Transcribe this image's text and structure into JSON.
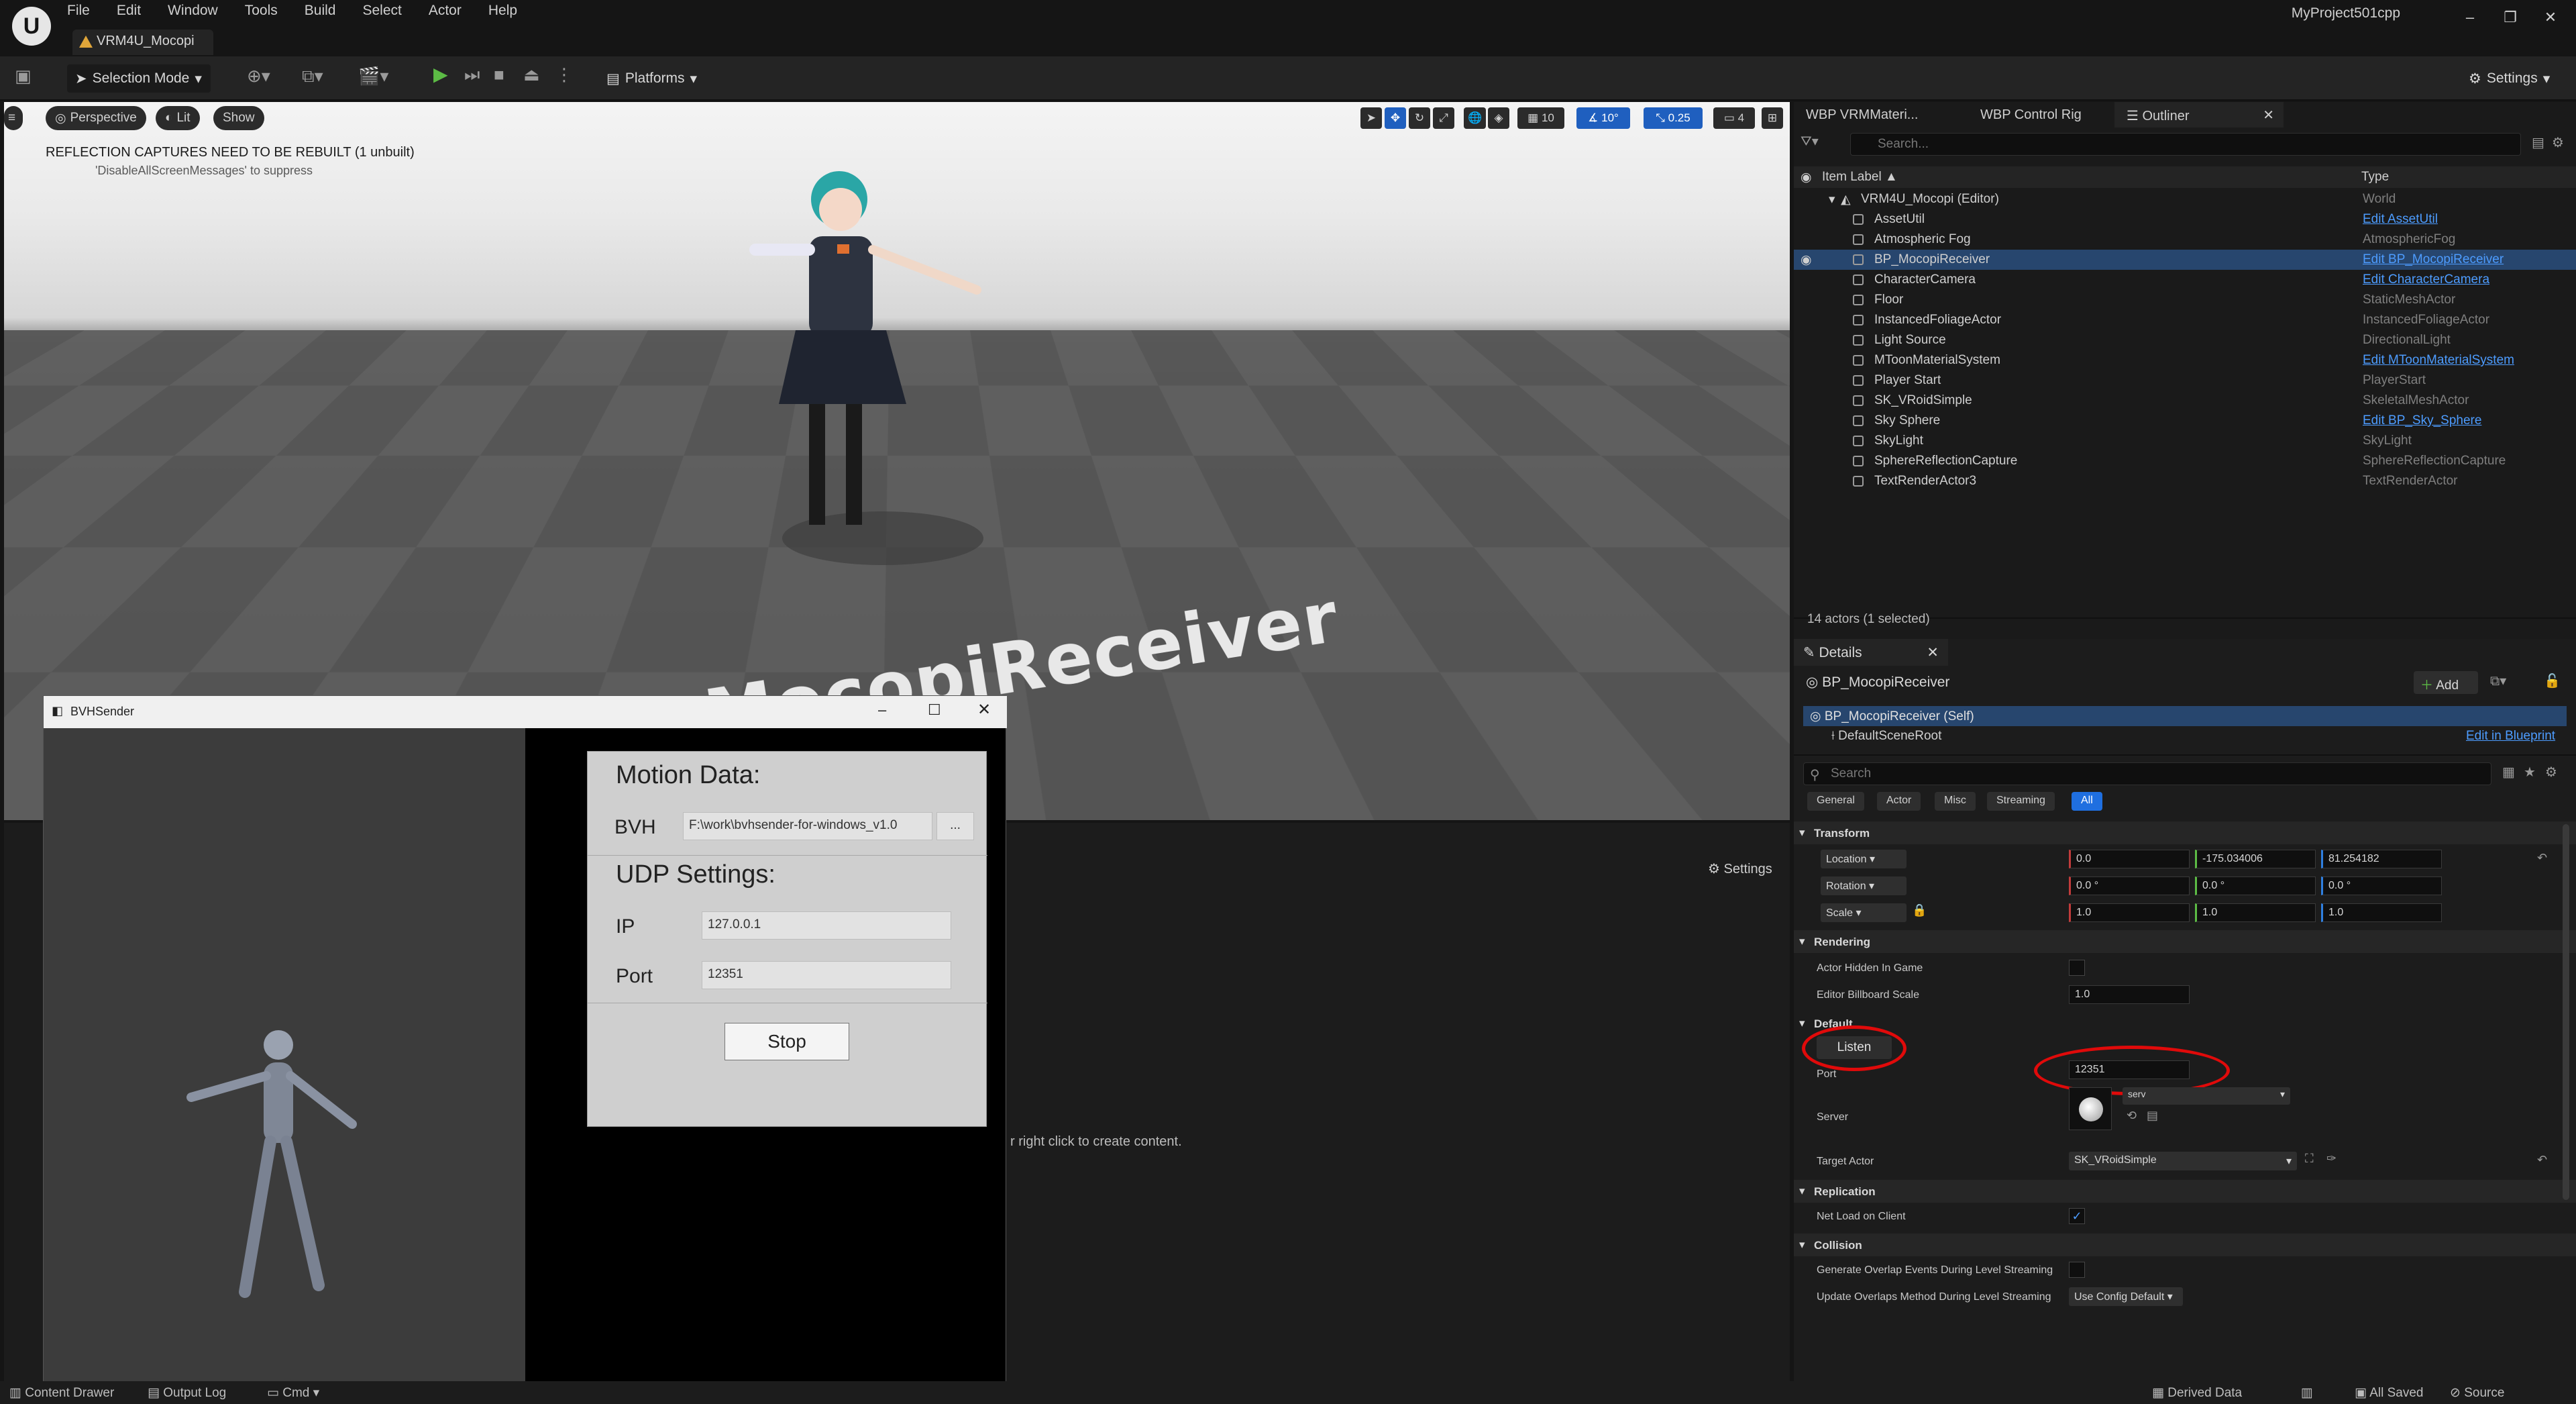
{
  "titlebar": {
    "menu": [
      "File",
      "Edit",
      "Window",
      "Tools",
      "Build",
      "Select",
      "Actor",
      "Help"
    ],
    "level_tab": "VRM4U_Mocopi",
    "project": "MyProject501cpp"
  },
  "toolbar": {
    "selection_mode": "Selection Mode",
    "platforms": "Platforms",
    "settings": "Settings"
  },
  "viewport": {
    "perspective": "Perspective",
    "lit": "Lit",
    "show": "Show",
    "grid_value": "10",
    "angle_value": "10°",
    "scale_value": "0.25",
    "camera_speed": "4",
    "warning": "REFLECTION CAPTURES NEED TO BE REBUILT (1 unbuilt)",
    "warning_sub": "'DisableAllScreenMessages' to suppress",
    "scene_text": "MocopiReceiver"
  },
  "content_browser": {
    "settings": "Settings",
    "hint": "r right click to create content."
  },
  "bvh_window": {
    "title": "BVHSender",
    "motion_heading": "Motion Data:",
    "bvh_label": "BVH",
    "bvh_path": "F:\\work\\bvhsender-for-windows_v1.0",
    "browse": "...",
    "udp_heading": "UDP Settings:",
    "ip_label": "IP",
    "ip_value": "127.0.0.1",
    "port_label": "Port",
    "port_value": "12351",
    "stop_label": "Stop"
  },
  "outliner": {
    "tabs": [
      "WBP VRMMateri...",
      "WBP Control Rig",
      "Outliner"
    ],
    "search_placeholder": "Search...",
    "col_label": "Item Label ▲",
    "col_type": "Type",
    "root": {
      "name": "VRM4U_Mocopi (Editor)",
      "type": "World"
    },
    "rows": [
      {
        "name": "AssetUtil",
        "type": "Edit AssetUtil",
        "link": true
      },
      {
        "name": "Atmospheric Fog",
        "type": "AtmosphericFog",
        "link": false
      },
      {
        "name": "BP_MocopiReceiver",
        "type": "Edit BP_MocopiReceiver",
        "link": true
      },
      {
        "name": "CharacterCamera",
        "type": "Edit CharacterCamera",
        "link": true
      },
      {
        "name": "Floor",
        "type": "StaticMeshActor",
        "link": false
      },
      {
        "name": "InstancedFoliageActor",
        "type": "InstancedFoliageActor",
        "link": false
      },
      {
        "name": "Light Source",
        "type": "DirectionalLight",
        "link": false
      },
      {
        "name": "MToonMaterialSystem",
        "type": "Edit MToonMaterialSystem",
        "link": true
      },
      {
        "name": "Player Start",
        "type": "PlayerStart",
        "link": false
      },
      {
        "name": "SK_VRoidSimple",
        "type": "SkeletalMeshActor",
        "link": false
      },
      {
        "name": "Sky Sphere",
        "type": "Edit BP_Sky_Sphere",
        "link": true
      },
      {
        "name": "SkyLight",
        "type": "SkyLight",
        "link": false
      },
      {
        "name": "SphereReflectionCapture",
        "type": "SphereReflectionCapture",
        "link": false
      },
      {
        "name": "TextRenderActor3",
        "type": "TextRenderActor",
        "link": false
      }
    ],
    "count": "14 actors (1 selected)"
  },
  "details": {
    "tab": "Details",
    "actor_name": "BP_MocopiReceiver",
    "add": "Add",
    "self_row": "BP_MocopiReceiver (Self)",
    "root_component": "DefaultSceneRoot",
    "edit_in_bp": "Edit in Blueprint",
    "search_placeholder": "Search",
    "filters": [
      "General",
      "Actor",
      "Misc",
      "Streaming",
      "All"
    ],
    "transform": {
      "section": "Transform",
      "location_label": "Location",
      "location": [
        "0.0",
        "-175.034006",
        "81.254182"
      ],
      "rotation_label": "Rotation",
      "rotation": [
        "0.0 °",
        "0.0 °",
        "0.0 °"
      ],
      "scale_label": "Scale",
      "scale": [
        "1.0",
        "1.0",
        "1.0"
      ]
    },
    "rendering": {
      "section": "Rendering",
      "hidden_label": "Actor Hidden In Game",
      "billboard_label": "Editor Billboard Scale",
      "billboard_value": "1.0"
    },
    "default": {
      "section": "Default",
      "listen": "Listen",
      "port_label": "Port",
      "port_value": "12351",
      "server_label": "Server",
      "server_value": "serv",
      "target_label": "Target Actor",
      "target_value": "SK_VRoidSimple"
    },
    "replication": {
      "section": "Replication",
      "net_load_label": "Net Load on Client"
    },
    "collision": {
      "section": "Collision",
      "overlap_label": "Generate Overlap Events During Level Streaming",
      "update_label": "Update Overlaps Method During Level Streaming",
      "update_value": "Use Config Default"
    }
  },
  "statusbar": {
    "content_drawer": "Content Drawer",
    "output_log": "Output Log",
    "cmd": "Cmd",
    "derived_data": "Derived Data",
    "all_saved": "All Saved",
    "source": "Source"
  },
  "colors": {
    "accent": "#1f6fe0",
    "link": "#4d9cff",
    "selection": "#27466e",
    "highlight_oval": "#e00a0a",
    "play": "#5cbb45"
  }
}
